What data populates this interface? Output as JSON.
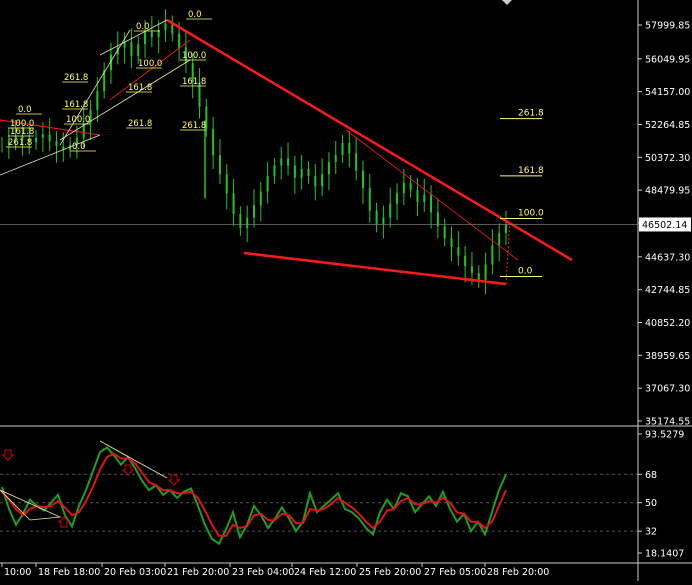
{
  "colors": {
    "background": "#000000",
    "candle": "#22c522",
    "trendline": "#ff1a1a",
    "fib_label": "#ffff66",
    "axis_text": "#ffffff",
    "grid": "#555555",
    "rsi_line": "#1f9e1f",
    "rsi_signal": "#e01414",
    "arrow": "#d40000"
  },
  "chart_data": [
    {
      "type": "candlestick",
      "panel": "price",
      "ylim": [
        35174.55,
        59935.2
      ],
      "yticks": [
        "57999.85",
        "56049.95",
        "54157.00",
        "52264.85",
        "50372.30",
        "48479.95",
        "46587.20",
        "44637.30",
        "42744.85",
        "40852.20",
        "38959.65",
        "37067.30",
        "35174.55"
      ],
      "current_price": "46502.14",
      "close_series": [
        51100,
        51350,
        51600,
        51400,
        51250,
        51500,
        51700,
        51300,
        51000,
        50800,
        51100,
        51500,
        52300,
        53100,
        54200,
        55400,
        56300,
        56700,
        57000,
        56200,
        56900,
        57600,
        57300,
        57700,
        58100,
        57500,
        56700,
        55800,
        54700,
        53300,
        52000,
        50500,
        49400,
        48300,
        47100,
        46300,
        46900,
        47600,
        48400,
        49300,
        49900,
        50300,
        49900,
        49200,
        49700,
        49300,
        48700,
        49400,
        50100,
        50500,
        51200,
        50600,
        49600,
        48600,
        47300,
        46500,
        46900,
        47700,
        48300,
        48900,
        48500,
        47800,
        48200,
        47200,
        46400,
        45700,
        45200,
        44700,
        44100,
        43700,
        43300,
        44200,
        45300,
        46000,
        46500
      ],
      "fib_levels": [
        {
          "label": "261.8",
          "value": 52600
        },
        {
          "label": "161.8",
          "value": 49300
        },
        {
          "label": "100.0",
          "value": 46850
        },
        {
          "label": "0.0",
          "value": 43500
        }
      ],
      "fib_small_labels": [
        "0.0",
        "0.0",
        "100.0",
        "100.0",
        "161.8",
        "161.8",
        "261.8",
        "261.8",
        "261.8",
        "0.0",
        "161.8",
        "100.0",
        "100.0",
        "161.8",
        "261.8",
        "0.0"
      ]
    },
    {
      "type": "line",
      "panel": "rsi",
      "ylim": [
        18.1407,
        93.5279
      ],
      "yticks": [
        "93.5279",
        "68",
        "50",
        "32",
        "18.1407"
      ],
      "levels": [
        68,
        50,
        32
      ],
      "series": [
        {
          "values": [
            60,
            46,
            36,
            43,
            52,
            48,
            45,
            50,
            55,
            42,
            35,
            48,
            58,
            70,
            82,
            85,
            80,
            74,
            79,
            72,
            64,
            58,
            61,
            55,
            58,
            53,
            57,
            59,
            48,
            36,
            27,
            24,
            33,
            44,
            28,
            36,
            48,
            42,
            34,
            40,
            47,
            40,
            32,
            38,
            56,
            44,
            48,
            52,
            56,
            46,
            44,
            40,
            34,
            30,
            44,
            52,
            46,
            56,
            54,
            44,
            49,
            54,
            48,
            57,
            46,
            38,
            43,
            32,
            38,
            30,
            44,
            58,
            68
          ]
        },
        {
          "values": [
            57,
            52,
            46,
            42,
            46,
            48,
            47,
            48,
            51,
            47,
            42,
            44,
            51,
            60,
            71,
            79,
            81,
            78,
            78,
            75,
            69,
            63,
            61,
            58,
            58,
            56,
            56,
            57,
            53,
            45,
            36,
            29,
            29,
            36,
            34,
            35,
            42,
            43,
            39,
            39,
            43,
            42,
            37,
            37,
            46,
            45,
            46,
            49,
            53,
            50,
            47,
            43,
            38,
            34,
            38,
            45,
            46,
            51,
            53,
            49,
            49,
            51,
            50,
            53,
            50,
            44,
            43,
            38,
            38,
            34,
            38,
            48,
            58
          ]
        }
      ]
    }
  ],
  "time_axis": {
    "labels": [
      "10:00",
      "18 Feb 18:00",
      "20 Feb 03:00",
      "21 Feb 20:00",
      "23 Feb 04:00",
      "24 Feb 12:00",
      "25 Feb 20:00",
      "27 Feb 05:00",
      "28 Feb 20:00"
    ]
  }
}
